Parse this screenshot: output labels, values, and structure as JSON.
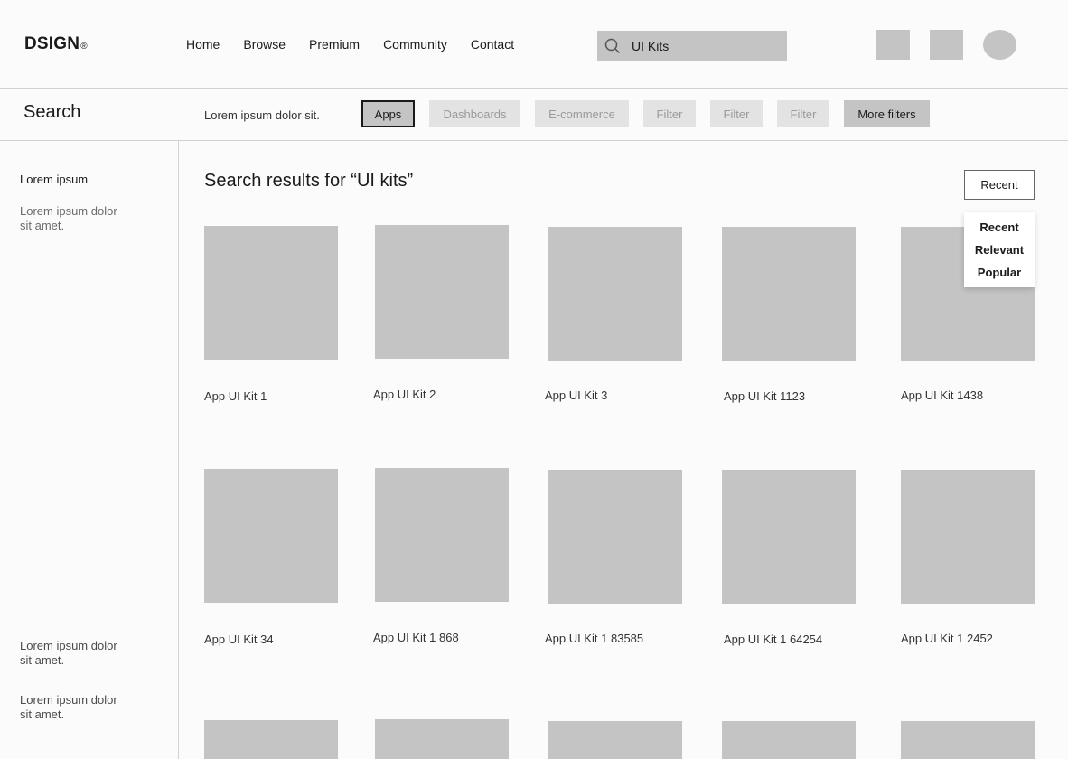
{
  "header": {
    "logo": "DSIGN",
    "logo_mark": "®",
    "nav": [
      "Home",
      "Browse",
      "Premium",
      "Community",
      "Contact"
    ],
    "search_value": "UI Kits"
  },
  "subbar": {
    "title": "Search",
    "description": "Lorem ipsum dolor sit.",
    "chips": [
      "Apps",
      "Dashboards",
      "E-commerce",
      "Filter",
      "Filter",
      "Filter",
      "More filters"
    ],
    "active_chip": "Apps"
  },
  "sidebar": {
    "heading": "Lorem ipsum",
    "items": [
      "Lorem ipsum dolor sit amet.",
      "Lorem ipsum dolor sit amet.",
      "Lorem ipsum dolor sit amet."
    ]
  },
  "main": {
    "title": "Search results for “UI kits”",
    "sort": {
      "selected": "Recent",
      "options": [
        "Recent",
        "Relevant",
        "Popular"
      ]
    },
    "results": [
      "App UI Kit 1",
      "App UI Kit 2",
      "App UI Kit 3",
      "App UI Kit 1123",
      "App UI Kit 1438",
      "App UI Kit 34",
      "App UI Kit 1 868",
      "App UI Kit 1 83585",
      "App UI Kit 1 64254",
      "App UI Kit 1 2452"
    ]
  }
}
